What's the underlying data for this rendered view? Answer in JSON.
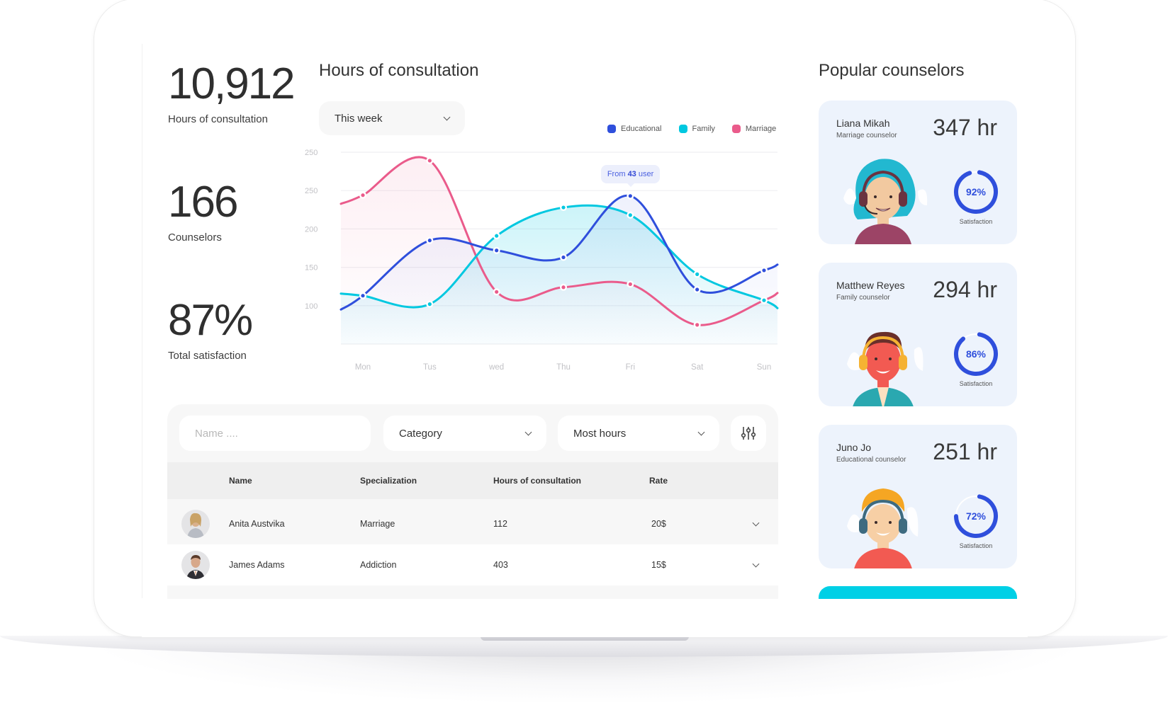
{
  "stats": [
    {
      "value": "10,912",
      "label": "Hours of consultation"
    },
    {
      "value": "166",
      "label": "Counselors"
    },
    {
      "value": "87%",
      "label": "Total satisfaction"
    }
  ],
  "chart_section": {
    "title": "Hours of consultation",
    "period_dropdown": {
      "selected": "This week"
    },
    "tooltip": {
      "prefix": "From ",
      "value": "43",
      "suffix": " user"
    }
  },
  "colors": {
    "educational": "#2f4fdc",
    "family": "#00c8e0",
    "marriage": "#ea5b8b",
    "accent_cyan": "#00d0e6",
    "card_bg": "#edf3fc"
  },
  "chart_data": {
    "type": "line",
    "title": "Hours of consultation",
    "xlabel": "",
    "ylabel": "",
    "categories": [
      "Mon",
      "Tus",
      "wed",
      "Thu",
      "Fri",
      "Sat",
      "Sun"
    ],
    "y_tick_labels": [
      "250",
      "250",
      "200",
      "150",
      "100"
    ],
    "ylim": [
      50,
      300
    ],
    "grid": true,
    "legend_position": "top-right",
    "series": [
      {
        "name": "Educational",
        "color": "#2f4fdc",
        "values": [
          113,
          185,
          172,
          163,
          243,
          121,
          146
        ]
      },
      {
        "name": "Family",
        "color": "#00c8e0",
        "values": [
          113,
          102,
          191,
          228,
          218,
          141,
          107
        ]
      },
      {
        "name": "Marriage",
        "color": "#ea5b8b",
        "values": [
          244,
          289,
          118,
          124,
          128,
          75,
          107
        ]
      }
    ],
    "annotations": [
      {
        "category": "Fri",
        "series": "Educational",
        "text": "From 43 user"
      }
    ]
  },
  "table": {
    "filters": {
      "name_placeholder": "Name ....",
      "category": "Category",
      "sort": "Most hours"
    },
    "columns": [
      "Name",
      "Specialization",
      "Hours of consultation",
      "Rate"
    ],
    "rows": [
      {
        "name": "Anita Austvika",
        "specialization": "Marriage",
        "hours": "112",
        "rate": "20$"
      },
      {
        "name": "James Adams",
        "specialization": "Addiction",
        "hours": "403",
        "rate": "15$"
      }
    ]
  },
  "counselors": {
    "title": "Popular counselors",
    "items": [
      {
        "name": "Liana Mikah",
        "role": "Marriage counselor",
        "hours": "347 hr",
        "satisfaction": 92,
        "satisfaction_label": "92%",
        "caption": "Satisfaction"
      },
      {
        "name": "Matthew Reyes",
        "role": "Family counselor",
        "hours": "294 hr",
        "satisfaction": 86,
        "satisfaction_label": "86%",
        "caption": "Satisfaction"
      },
      {
        "name": "Juno Jo",
        "role": "Educational counselor",
        "hours": "251 hr",
        "satisfaction": 72,
        "satisfaction_label": "72%",
        "caption": "Satisfaction"
      }
    ]
  }
}
